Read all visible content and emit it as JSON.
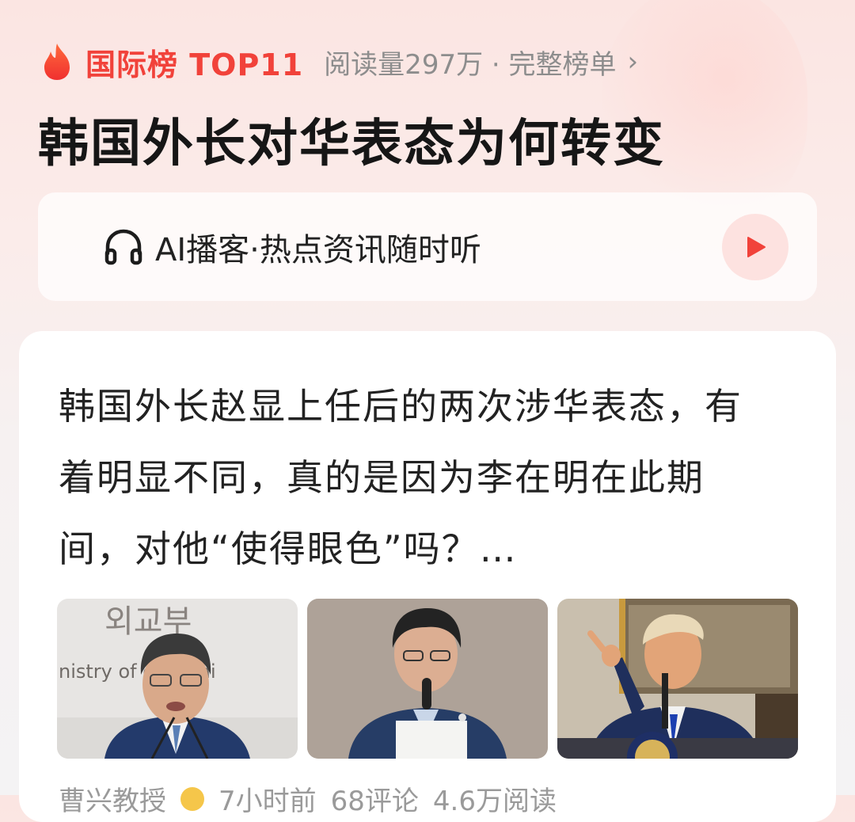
{
  "ranking": {
    "label": "国际榜 TOP11",
    "meta": "阅读量297万 · 完整榜单",
    "chevron": "›",
    "icon": "flame-icon",
    "accent_color": "#f1423a"
  },
  "headline": "韩国外长对华表态为何转变",
  "podcast": {
    "label": "AI播客·热点资讯随时听",
    "icon": "headphones-icon",
    "play_icon": "play-icon",
    "play_color": "#f1423a"
  },
  "article": {
    "excerpt": "韩国外长赵显上任后的两次涉华表态，有着明显不同，真的是因为李在明在此期间，对他“使得眼色”吗？…",
    "images": [
      {
        "name": "thumbnail-foreign-minister",
        "sign_top": "외교부",
        "sign_bottom": "nistry of      gn Affai"
      },
      {
        "name": "thumbnail-president-lee"
      },
      {
        "name": "thumbnail-trump-podium"
      }
    ],
    "source": "曹兴教授",
    "time": "7小时前",
    "comments": "68评论",
    "reads": "4.6万阅读"
  }
}
